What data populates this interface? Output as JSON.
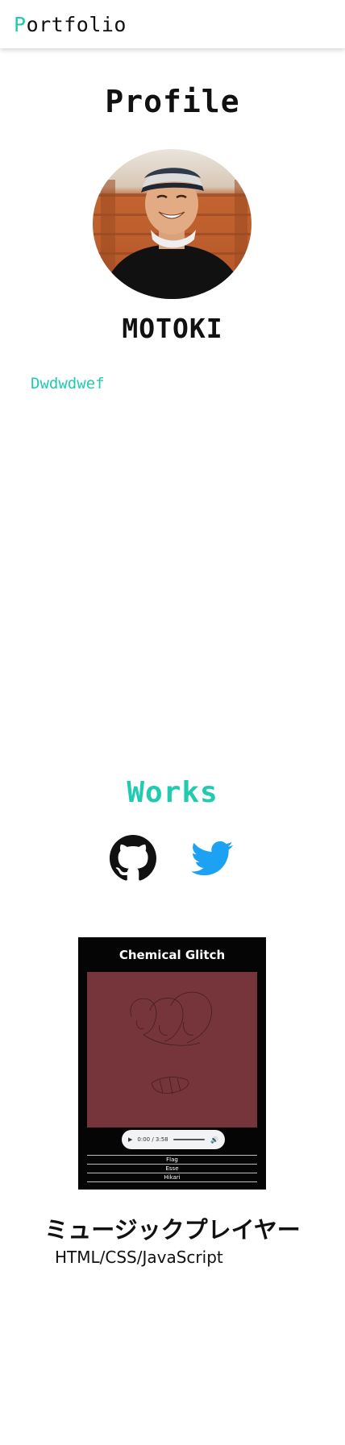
{
  "header": {
    "logo_first_letter": "P",
    "logo_rest": "ortfolio",
    "accent_color": "#20cbb0"
  },
  "profile": {
    "title": "Profile",
    "name": "MOTOKI",
    "bio": "Dwdwdwef",
    "avatar_alt": "profile photo"
  },
  "works": {
    "title": "Works",
    "social": [
      {
        "name": "GitHub",
        "icon": "github-icon",
        "color": "#111111"
      },
      {
        "name": "Twitter",
        "icon": "twitter-icon",
        "color": "#1da1f2"
      }
    ],
    "items": [
      {
        "player": {
          "title": "Chemical Glitch",
          "time": "0:00 / 3:58",
          "progress": 0,
          "tracks": [
            "Flag",
            "Esse",
            "Hikari"
          ],
          "art_color": "#76353a"
        },
        "title": "ミュージックプレイヤー",
        "tech": "HTML/CSS/JavaScript"
      }
    ]
  }
}
